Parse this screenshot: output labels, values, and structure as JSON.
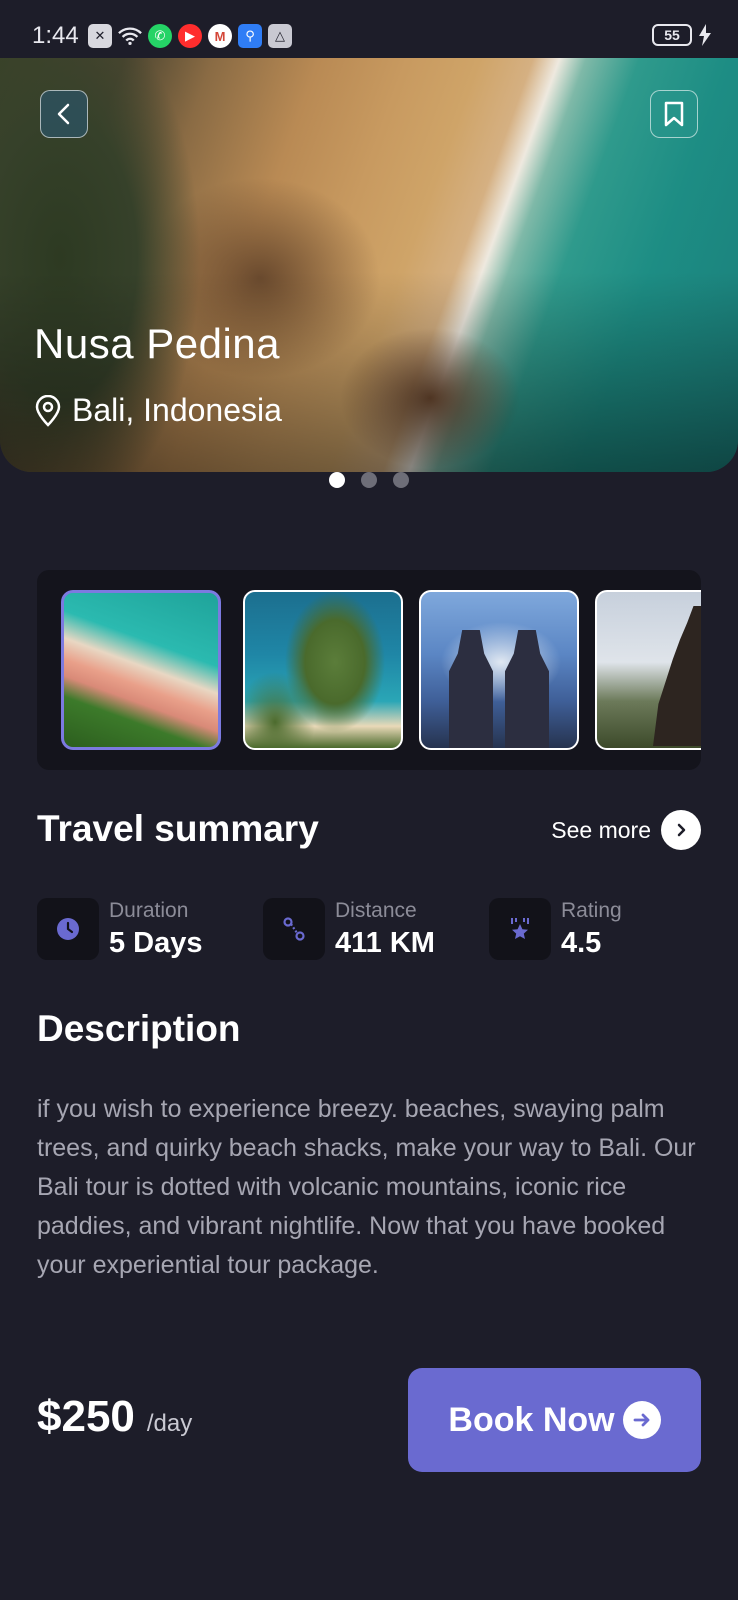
{
  "status_bar": {
    "time": "1:44",
    "battery": "55"
  },
  "hero": {
    "title": "Nusa Pedina",
    "location": "Bali, Indonesia",
    "page_count": 3,
    "active_page": 1
  },
  "gallery": {
    "thumbnails": [
      "beach-cliff",
      "kelingking-beach",
      "temple-gate",
      "pagoda-temple"
    ],
    "selected_index": 0
  },
  "summary": {
    "title": "Travel summary",
    "see_more": "See more",
    "stats": [
      {
        "label": "Duration",
        "value": "5 Days",
        "icon": "clock-icon"
      },
      {
        "label": "Distance",
        "value": "411 KM",
        "icon": "route-icon"
      },
      {
        "label": "Rating",
        "value": "4.5",
        "icon": "star-badge-icon"
      }
    ]
  },
  "description": {
    "title": "Description",
    "text": "if you wish to experience breezy. beaches, swaying palm trees, and quirky beach shacks, make your way to Bali. Our Bali tour is dotted with volcanic mountains, iconic rice paddies, and vibrant nightlife. Now that you have booked your experiential tour package."
  },
  "footer": {
    "price": "$250",
    "price_unit": "/day",
    "book_label": "Book Now"
  },
  "colors": {
    "background": "#1d1d29",
    "accent": "#6a6ad0",
    "card": "#121219"
  }
}
